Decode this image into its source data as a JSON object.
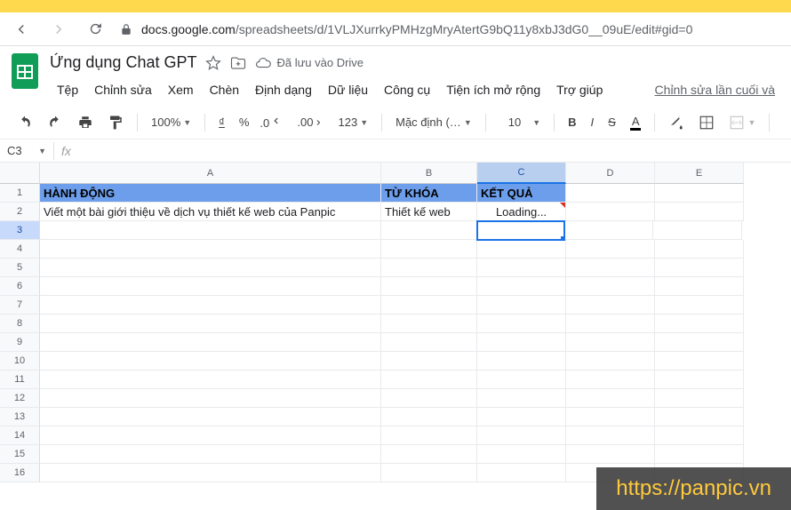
{
  "browser": {
    "url_host": "docs.google.com",
    "url_path": "/spreadsheets/d/1VLJXurrkyPMHzgMryAtertG9bQ11y8xbJ3dG0__09uE/edit#gid=0"
  },
  "doc": {
    "title": "Ứng dụng Chat GPT",
    "drive_status": "Đã lưu vào Drive"
  },
  "menus": {
    "file": "Tệp",
    "edit": "Chỉnh sửa",
    "view": "Xem",
    "insert": "Chèn",
    "format": "Định dạng",
    "data": "Dữ liệu",
    "tools": "Công cụ",
    "extensions": "Tiện ích mở rộng",
    "help": "Trợ giúp",
    "last_edit": "Chỉnh sửa lần cuối và"
  },
  "toolbar": {
    "zoom": "100%",
    "currency": "₫",
    "percent": "%",
    "dec_dec": ".0",
    "dec_inc": ".00",
    "num_format": "123",
    "font": "Mặc định (…",
    "font_size": "10",
    "bold": "B",
    "italic": "I",
    "strike": "S",
    "text_color": "A"
  },
  "name_box": "C3",
  "cols": {
    "A": "A",
    "B": "B",
    "C": "C",
    "D": "D",
    "E": "E"
  },
  "rows": [
    "1",
    "2",
    "3",
    "4",
    "5",
    "6",
    "7",
    "8",
    "9",
    "10",
    "11",
    "12",
    "13",
    "14",
    "15",
    "16"
  ],
  "cells": {
    "A1": "HÀNH ĐỘNG",
    "B1": "TỪ KHÓA",
    "C1": "KẾT QUẢ",
    "A2": "Viết một bài giới thiệu về dịch vụ thiết kế web của Panpic",
    "B2": "Thiết kế web",
    "C2": "Loading..."
  },
  "watermark": "https://panpic.vn"
}
